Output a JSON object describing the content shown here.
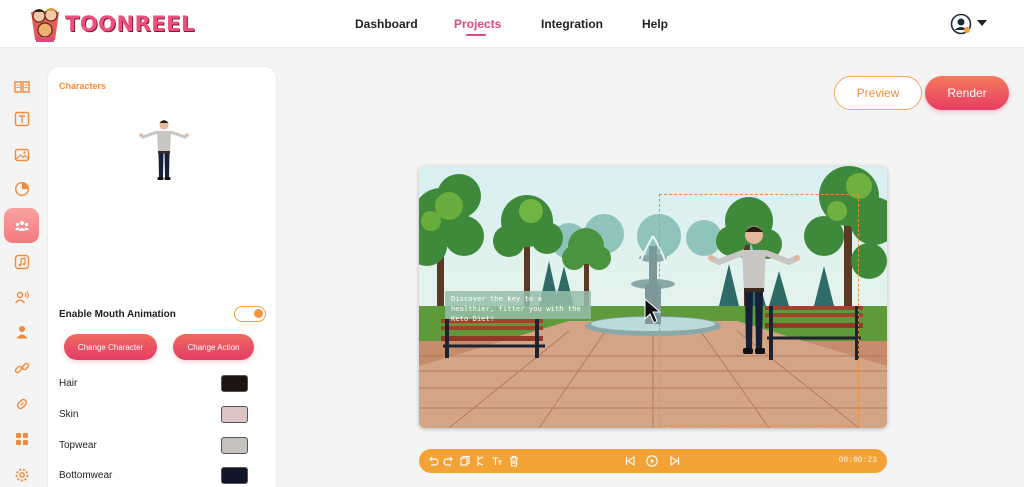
{
  "brand": {
    "name": "TOONREEL",
    "accent": "#e14b77",
    "secondary": "#f3a336"
  },
  "nav": {
    "items": [
      {
        "label": "Dashboard",
        "active": false
      },
      {
        "label": "Projects",
        "active": true
      },
      {
        "label": "Integration",
        "active": false
      },
      {
        "label": "Help",
        "active": false
      }
    ],
    "account_icon": "user-avatar-icon"
  },
  "rail": {
    "items": [
      {
        "icon": "book-icon",
        "active": false
      },
      {
        "icon": "text-icon",
        "active": false
      },
      {
        "icon": "image-icon",
        "active": false
      },
      {
        "icon": "sticker-icon",
        "active": false
      },
      {
        "icon": "characters-icon",
        "active": true
      },
      {
        "icon": "music-icon",
        "active": false
      },
      {
        "icon": "voice-icon",
        "active": false
      },
      {
        "icon": "person-icon",
        "active": false
      },
      {
        "icon": "link-icon",
        "active": false
      },
      {
        "icon": "tag-icon",
        "active": false
      },
      {
        "icon": "apps-icon",
        "active": false
      },
      {
        "icon": "settings-icon",
        "active": false
      }
    ]
  },
  "panel": {
    "title": "Characters",
    "mouth_animation_label": "Enable Mouth Animation",
    "mouth_animation_enabled": true,
    "change_character_label": "Change Character",
    "change_action_label": "Change Action",
    "attributes": [
      {
        "label": "Hair",
        "color": "#1e1512"
      },
      {
        "label": "Skin",
        "color": "#dcc4c4"
      },
      {
        "label": "Topwear",
        "color": "#c4c0bc"
      },
      {
        "label": "Bottomwear",
        "color": "#0e1628"
      }
    ]
  },
  "actions": {
    "preview_label": "Preview",
    "render_label": "Render"
  },
  "scene": {
    "caption": "Discover the key to a healthier, fitter you with the Keto Diet!"
  },
  "timeline": {
    "left_icons": [
      "undo-icon",
      "redo-icon",
      "duplicate-icon",
      "split-icon",
      "text-format-icon",
      "delete-icon"
    ],
    "center_icons": [
      "skip-back-icon",
      "play-icon",
      "skip-forward-icon"
    ],
    "time": "00:00:23"
  }
}
